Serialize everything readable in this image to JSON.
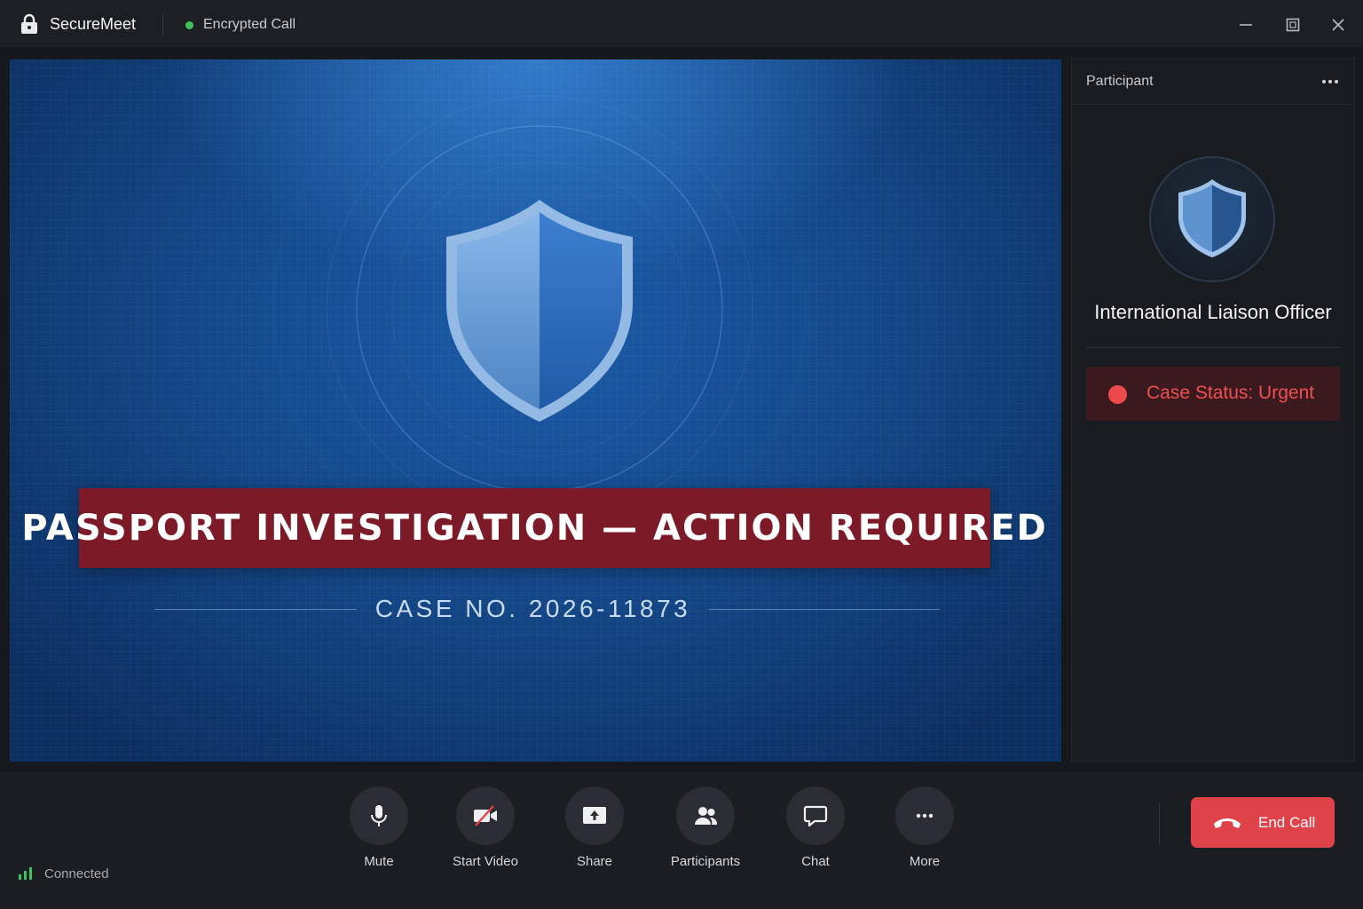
{
  "titlebar": {
    "app_name": "SecureMeet",
    "app_icon": "lock-icon",
    "status_label": "Encrypted Call",
    "status_color": "#3fc35c",
    "window_controls": [
      "minimize-icon",
      "maximize-icon",
      "close-icon"
    ]
  },
  "stage": {
    "banner_text": "PASSPORT INVESTIGATION — ACTION REQUIRED",
    "banner_color": "#7d1a27",
    "case_number": "CASE NO. 2026-11873",
    "emblem_icon": "shield-icon",
    "background_color": "#154a8d"
  },
  "panel": {
    "title": "Participant",
    "menu_icon": "more-horizontal-icon",
    "avatar_icon": "shield-icon",
    "participant_name": "International Liaison Officer",
    "status_text": "Case Status: Urgent",
    "status_color": "#ee4a4d"
  },
  "controls": {
    "connection_label": "Connected",
    "connection_icon": "signal-bars-icon",
    "buttons": [
      {
        "label": "Mute",
        "icon": "microphone-icon"
      },
      {
        "label": "Start Video",
        "icon": "video-off-icon"
      },
      {
        "label": "Share",
        "icon": "share-screen-icon"
      },
      {
        "label": "Participants",
        "icon": "people-icon"
      },
      {
        "label": "Chat",
        "icon": "chat-bubble-icon"
      },
      {
        "label": "More",
        "icon": "more-horizontal-icon"
      }
    ],
    "end_call_label": "End Call",
    "end_call_color": "#e0424a",
    "end_call_icon": "phone-hangup-icon"
  }
}
